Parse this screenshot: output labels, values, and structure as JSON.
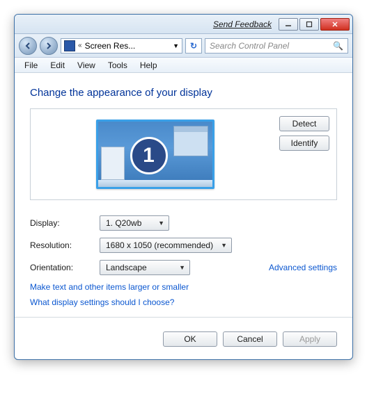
{
  "titlebar": {
    "feedback": "Send Feedback"
  },
  "nav": {
    "address": "Screen Res...",
    "search_placeholder": "Search Control Panel"
  },
  "menu": [
    "File",
    "Edit",
    "View",
    "Tools",
    "Help"
  ],
  "heading": "Change the appearance of your display",
  "preview": {
    "monitor_number": "1",
    "detect": "Detect",
    "identify": "Identify"
  },
  "settings": {
    "display_label": "Display:",
    "display_value": "1. Q20wb",
    "resolution_label": "Resolution:",
    "resolution_value": "1680 x 1050 (recommended)",
    "orientation_label": "Orientation:",
    "orientation_value": "Landscape",
    "advanced": "Advanced settings"
  },
  "links": {
    "text_size": "Make text and other items larger or smaller",
    "help": "What display settings should I choose?"
  },
  "buttons": {
    "ok": "OK",
    "cancel": "Cancel",
    "apply": "Apply"
  }
}
